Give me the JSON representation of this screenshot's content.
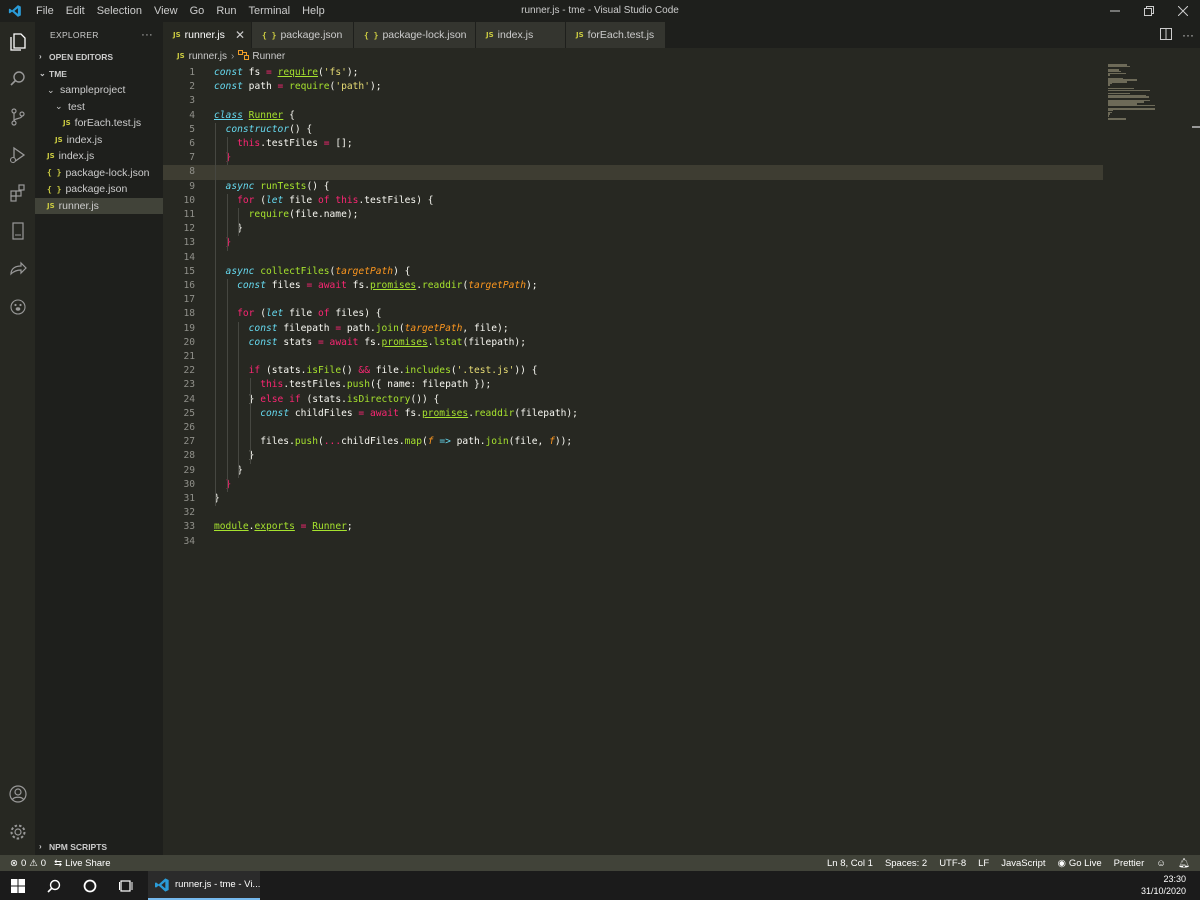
{
  "window": {
    "title": "runner.js - tme - Visual Studio Code",
    "menus": [
      "File",
      "Edit",
      "Selection",
      "View",
      "Go",
      "Run",
      "Terminal",
      "Help"
    ]
  },
  "sidebar": {
    "title": "EXPLORER",
    "more": "···",
    "open_editors": "OPEN EDITORS",
    "workspace": "TME",
    "npm_scripts": "NPM SCRIPTS",
    "tree": [
      {
        "label": "sampleproject",
        "kind": "folder"
      },
      {
        "label": "test",
        "kind": "folder"
      },
      {
        "label": "forEach.test.js",
        "kind": "js"
      },
      {
        "label": "index.js",
        "kind": "js"
      },
      {
        "label": "index.js",
        "kind": "js"
      },
      {
        "label": "package-lock.json",
        "kind": "json"
      },
      {
        "label": "package.json",
        "kind": "json"
      },
      {
        "label": "runner.js",
        "kind": "js"
      }
    ]
  },
  "tabs": [
    {
      "label": "runner.js",
      "kind": "js"
    },
    {
      "label": "package.json",
      "kind": "json"
    },
    {
      "label": "package-lock.json",
      "kind": "json"
    },
    {
      "label": "index.js",
      "kind": "js"
    },
    {
      "label": "forEach.test.js",
      "kind": "js"
    }
  ],
  "icons": {
    "js": "JS",
    "json": "{ }",
    "close": "✕"
  },
  "breadcrumb": {
    "file": "runner.js",
    "symbol": "Runner"
  },
  "editor": {
    "current_line": 8,
    "lines": [
      [
        [
          "const",
          "k"
        ],
        [
          " fs ",
          "t"
        ],
        [
          "=",
          "kw"
        ],
        [
          " ",
          "t"
        ],
        [
          "require",
          "f u"
        ],
        [
          "(",
          "t"
        ],
        [
          "'fs'",
          "s"
        ],
        [
          ");",
          "t"
        ]
      ],
      [
        [
          "const",
          "k"
        ],
        [
          " path ",
          "t"
        ],
        [
          "=",
          "kw"
        ],
        [
          " ",
          "t"
        ],
        [
          "require",
          "f"
        ],
        [
          "(",
          "t"
        ],
        [
          "'path'",
          "s"
        ],
        [
          ");",
          "t"
        ]
      ],
      [],
      [
        [
          "class",
          "k u"
        ],
        [
          " ",
          "t"
        ],
        [
          "Runner",
          "f u"
        ],
        [
          " {",
          "t"
        ]
      ],
      [
        [
          "  ",
          "t"
        ],
        [
          "constructor",
          "k"
        ],
        [
          "() {",
          "t"
        ]
      ],
      [
        [
          "    ",
          "t"
        ],
        [
          "this",
          "kw"
        ],
        [
          ".testFiles ",
          "t"
        ],
        [
          "=",
          "kw"
        ],
        [
          " [];",
          "t"
        ]
      ],
      [
        [
          "  }",
          "kw"
        ]
      ],
      [],
      [
        [
          "  async",
          "k"
        ],
        [
          " ",
          "t"
        ],
        [
          "runTests",
          "f"
        ],
        [
          "() {",
          "t"
        ]
      ],
      [
        [
          "    ",
          "t"
        ],
        [
          "for",
          "kw"
        ],
        [
          " (",
          "t"
        ],
        [
          "let",
          "k"
        ],
        [
          " file ",
          "t"
        ],
        [
          "of",
          "kw"
        ],
        [
          " ",
          "t"
        ],
        [
          "this",
          "kw"
        ],
        [
          ".testFiles) {",
          "t"
        ]
      ],
      [
        [
          "      ",
          "t"
        ],
        [
          "require",
          "f"
        ],
        [
          "(file.name);",
          "t"
        ]
      ],
      [
        [
          "    }",
          "t"
        ]
      ],
      [
        [
          "  }",
          "kw"
        ]
      ],
      [],
      [
        [
          "  async",
          "k"
        ],
        [
          " ",
          "t"
        ],
        [
          "collectFiles",
          "f"
        ],
        [
          "(",
          "t"
        ],
        [
          "targetPath",
          "p"
        ],
        [
          ") {",
          "t"
        ]
      ],
      [
        [
          "    ",
          "t"
        ],
        [
          "const",
          "k"
        ],
        [
          " files ",
          "t"
        ],
        [
          "=",
          "kw"
        ],
        [
          " ",
          "t"
        ],
        [
          "await",
          "kw"
        ],
        [
          " fs.",
          "t"
        ],
        [
          "promises",
          "f u"
        ],
        [
          ".",
          "t"
        ],
        [
          "readdir",
          "f"
        ],
        [
          "(",
          "t"
        ],
        [
          "targetPath",
          "p"
        ],
        [
          ");",
          "t"
        ]
      ],
      [],
      [
        [
          "    ",
          "t"
        ],
        [
          "for",
          "kw"
        ],
        [
          " (",
          "t"
        ],
        [
          "let",
          "k"
        ],
        [
          " file ",
          "t"
        ],
        [
          "of",
          "kw"
        ],
        [
          " files) {",
          "t"
        ]
      ],
      [
        [
          "      ",
          "t"
        ],
        [
          "const",
          "k"
        ],
        [
          " filepath ",
          "t"
        ],
        [
          "=",
          "kw"
        ],
        [
          " path.",
          "t"
        ],
        [
          "join",
          "f"
        ],
        [
          "(",
          "t"
        ],
        [
          "targetPath",
          "p"
        ],
        [
          ", file);",
          "t"
        ]
      ],
      [
        [
          "      ",
          "t"
        ],
        [
          "const",
          "k"
        ],
        [
          " stats ",
          "t"
        ],
        [
          "=",
          "kw"
        ],
        [
          " ",
          "t"
        ],
        [
          "await",
          "kw"
        ],
        [
          " fs.",
          "t"
        ],
        [
          "promises",
          "f u"
        ],
        [
          ".",
          "t"
        ],
        [
          "lstat",
          "f"
        ],
        [
          "(filepath);",
          "t"
        ]
      ],
      [],
      [
        [
          "      ",
          "t"
        ],
        [
          "if",
          "kw"
        ],
        [
          " (stats.",
          "t"
        ],
        [
          "isFile",
          "f"
        ],
        [
          "() ",
          "t"
        ],
        [
          "&&",
          "kw"
        ],
        [
          " file.",
          "t"
        ],
        [
          "includes",
          "f"
        ],
        [
          "(",
          "t"
        ],
        [
          "'.test.js'",
          "s"
        ],
        [
          ")) {",
          "t"
        ]
      ],
      [
        [
          "        ",
          "t"
        ],
        [
          "this",
          "kw"
        ],
        [
          ".testFiles.",
          "t"
        ],
        [
          "push",
          "f"
        ],
        [
          "({ name: filepath });",
          "t"
        ]
      ],
      [
        [
          "      } ",
          "t"
        ],
        [
          "else",
          "kw"
        ],
        [
          " ",
          "t"
        ],
        [
          "if",
          "kw"
        ],
        [
          " (stats.",
          "t"
        ],
        [
          "isDirectory",
          "f"
        ],
        [
          "()) {",
          "t"
        ]
      ],
      [
        [
          "        ",
          "t"
        ],
        [
          "const",
          "k"
        ],
        [
          " childFiles ",
          "t"
        ],
        [
          "=",
          "kw"
        ],
        [
          " ",
          "t"
        ],
        [
          "await",
          "kw"
        ],
        [
          " fs.",
          "t"
        ],
        [
          "promises",
          "f u"
        ],
        [
          ".",
          "t"
        ],
        [
          "readdir",
          "f"
        ],
        [
          "(filepath);",
          "t"
        ]
      ],
      [],
      [
        [
          "        files.",
          "t"
        ],
        [
          "push",
          "f"
        ],
        [
          "(",
          "t"
        ],
        [
          "...",
          "kw"
        ],
        [
          "childFiles.",
          "t"
        ],
        [
          "map",
          "f"
        ],
        [
          "(",
          "t"
        ],
        [
          "f",
          "p"
        ],
        [
          " ",
          "t"
        ],
        [
          "=>",
          "k"
        ],
        [
          " path.",
          "t"
        ],
        [
          "join",
          "f"
        ],
        [
          "(file, ",
          "t"
        ],
        [
          "f",
          "p"
        ],
        [
          "));",
          "t"
        ]
      ],
      [
        [
          "      }",
          "t"
        ]
      ],
      [
        [
          "    }",
          "t"
        ]
      ],
      [
        [
          "  }",
          "kw"
        ]
      ],
      [
        [
          "}",
          "t"
        ]
      ],
      [],
      [
        [
          "module",
          "f u"
        ],
        [
          ".",
          "t"
        ],
        [
          "exports",
          "f u"
        ],
        [
          " ",
          "t"
        ],
        [
          "=",
          "kw"
        ],
        [
          " ",
          "t"
        ],
        [
          "Runner",
          "f u"
        ],
        [
          ";",
          "t"
        ]
      ],
      []
    ]
  },
  "status": {
    "errors": "0",
    "warnings": "0",
    "live_share": "Live Share",
    "position": "Ln 8, Col 1",
    "spaces": "Spaces: 2",
    "encoding": "UTF-8",
    "eol": "LF",
    "language": "JavaScript",
    "go_live": "Go Live",
    "prettier": "Prettier"
  },
  "taskbar": {
    "app": "runner.js - tme - Vi...",
    "time": "23:30",
    "date": "31/10/2020"
  },
  "colors": {
    "accent": "#007acc",
    "editor_bg": "#272822",
    "sidebar_bg": "#1e1f1c",
    "status_bg": "#414339"
  }
}
